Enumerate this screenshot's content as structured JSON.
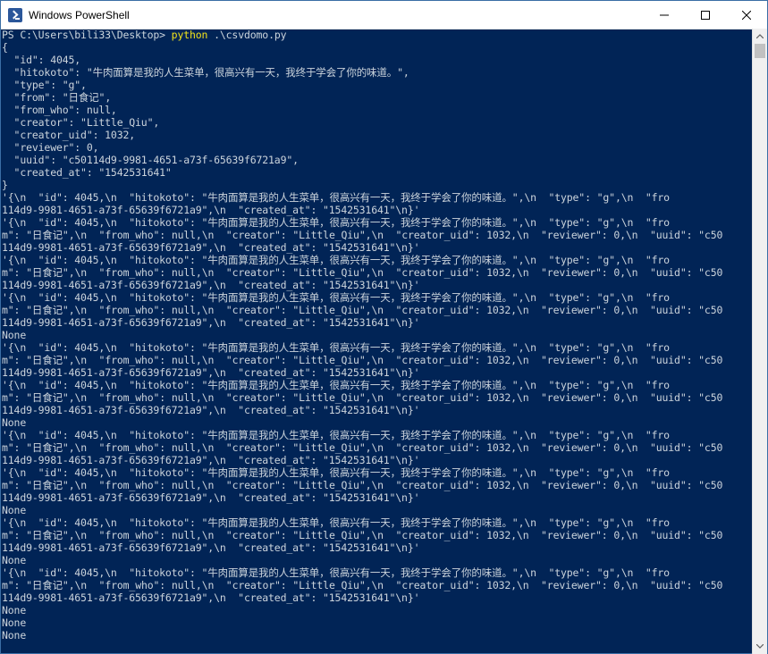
{
  "window": {
    "title": "Windows PowerShell",
    "icon": "powershell-icon",
    "colors": {
      "background": "#012456",
      "text": "#ccd4dc",
      "command": "#f2e21b"
    }
  },
  "terminal": {
    "prompt": "PS C:\\Users\\bili33\\Desktop> ",
    "command": "python",
    "args": " .\\csvdomo.py",
    "lines": [
      "{",
      "  \"id\": 4045,",
      "  \"hitokoto\": \"牛肉面算是我的人生菜单，很高兴有一天，我终于学会了你的味道。\",",
      "  \"type\": \"g\",",
      "  \"from\": \"日食记\",",
      "  \"from_who\": null,",
      "  \"creator\": \"Little_Qiu\",",
      "  \"creator_uid\": 1032,",
      "  \"reviewer\": 0,",
      "  \"uuid\": \"c50114d9-9981-4651-a73f-65639f6721a9\",",
      "  \"created_at\": \"1542531641\"",
      "}",
      "'{\\n  \"id\": 4045,\\n  \"hitokoto\": \"牛肉面算是我的人生菜单，很高兴有一天，我终于学会了你的味道。\",\\n  \"type\": \"g\",\\n  \"fro",
      "114d9-9981-4651-a73f-65639f6721a9\",\\n  \"created_at\": \"1542531641\"\\n}'",
      "'{\\n  \"id\": 4045,\\n  \"hitokoto\": \"牛肉面算是我的人生菜单，很高兴有一天，我终于学会了你的味道。\",\\n  \"type\": \"g\",\\n  \"fro",
      "m\": \"日食记\",\\n  \"from_who\": null,\\n  \"creator\": \"Little_Qiu\",\\n  \"creator_uid\": 1032,\\n  \"reviewer\": 0,\\n  \"uuid\": \"c50",
      "114d9-9981-4651-a73f-65639f6721a9\",\\n  \"created_at\": \"1542531641\"\\n}'",
      "'{\\n  \"id\": 4045,\\n  \"hitokoto\": \"牛肉面算是我的人生菜单，很高兴有一天，我终于学会了你的味道。\",\\n  \"type\": \"g\",\\n  \"fro",
      "m\": \"日食记\",\\n  \"from_who\": null,\\n  \"creator\": \"Little_Qiu\",\\n  \"creator_uid\": 1032,\\n  \"reviewer\": 0,\\n  \"uuid\": \"c50",
      "114d9-9981-4651-a73f-65639f6721a9\",\\n  \"created_at\": \"1542531641\"\\n}'",
      "'{\\n  \"id\": 4045,\\n  \"hitokoto\": \"牛肉面算是我的人生菜单，很高兴有一天，我终于学会了你的味道。\",\\n  \"type\": \"g\",\\n  \"fro",
      "m\": \"日食记\",\\n  \"from_who\": null,\\n  \"creator\": \"Little_Qiu\",\\n  \"creator_uid\": 1032,\\n  \"reviewer\": 0,\\n  \"uuid\": \"c50",
      "114d9-9981-4651-a73f-65639f6721a9\",\\n  \"created_at\": \"1542531641\"\\n}'",
      "None",
      "'{\\n  \"id\": 4045,\\n  \"hitokoto\": \"牛肉面算是我的人生菜单，很高兴有一天，我终于学会了你的味道。\",\\n  \"type\": \"g\",\\n  \"fro",
      "m\": \"日食记\",\\n  \"from_who\": null,\\n  \"creator\": \"Little_Qiu\",\\n  \"creator_uid\": 1032,\\n  \"reviewer\": 0,\\n  \"uuid\": \"c50",
      "114d9-9981-4651-a73f-65639f6721a9\",\\n  \"created_at\": \"1542531641\"\\n}'",
      "'{\\n  \"id\": 4045,\\n  \"hitokoto\": \"牛肉面算是我的人生菜单，很高兴有一天，我终于学会了你的味道。\",\\n  \"type\": \"g\",\\n  \"fro",
      "m\": \"日食记\",\\n  \"from_who\": null,\\n  \"creator\": \"Little_Qiu\",\\n  \"creator_uid\": 1032,\\n  \"reviewer\": 0,\\n  \"uuid\": \"c50",
      "114d9-9981-4651-a73f-65639f6721a9\",\\n  \"created_at\": \"1542531641\"\\n}'",
      "None",
      "'{\\n  \"id\": 4045,\\n  \"hitokoto\": \"牛肉面算是我的人生菜单，很高兴有一天，我终于学会了你的味道。\",\\n  \"type\": \"g\",\\n  \"fro",
      "m\": \"日食记\",\\n  \"from_who\": null,\\n  \"creator\": \"Little_Qiu\",\\n  \"creator_uid\": 1032,\\n  \"reviewer\": 0,\\n  \"uuid\": \"c50",
      "114d9-9981-4651-a73f-65639f6721a9\",\\n  \"created_at\": \"1542531641\"\\n}'",
      "'{\\n  \"id\": 4045,\\n  \"hitokoto\": \"牛肉面算是我的人生菜单，很高兴有一天，我终于学会了你的味道。\",\\n  \"type\": \"g\",\\n  \"fro",
      "m\": \"日食记\",\\n  \"from_who\": null,\\n  \"creator\": \"Little_Qiu\",\\n  \"creator_uid\": 1032,\\n  \"reviewer\": 0,\\n  \"uuid\": \"c50",
      "114d9-9981-4651-a73f-65639f6721a9\",\\n  \"created_at\": \"1542531641\"\\n}'",
      "None",
      "'{\\n  \"id\": 4045,\\n  \"hitokoto\": \"牛肉面算是我的人生菜单，很高兴有一天，我终于学会了你的味道。\",\\n  \"type\": \"g\",\\n  \"fro",
      "m\": \"日食记\",\\n  \"from_who\": null,\\n  \"creator\": \"Little_Qiu\",\\n  \"creator_uid\": 1032,\\n  \"reviewer\": 0,\\n  \"uuid\": \"c50",
      "114d9-9981-4651-a73f-65639f6721a9\",\\n  \"created_at\": \"1542531641\"\\n}'",
      "None",
      "'{\\n  \"id\": 4045,\\n  \"hitokoto\": \"牛肉面算是我的人生菜单，很高兴有一天，我终于学会了你的味道。\",\\n  \"type\": \"g\",\\n  \"fro",
      "m\": \"日食记\",\\n  \"from_who\": null,\\n  \"creator\": \"Little_Qiu\",\\n  \"creator_uid\": 1032,\\n  \"reviewer\": 0,\\n  \"uuid\": \"c50",
      "114d9-9981-4651-a73f-65639f6721a9\",\\n  \"created_at\": \"1542531641\"\\n}'",
      "None",
      "None",
      "None"
    ]
  }
}
